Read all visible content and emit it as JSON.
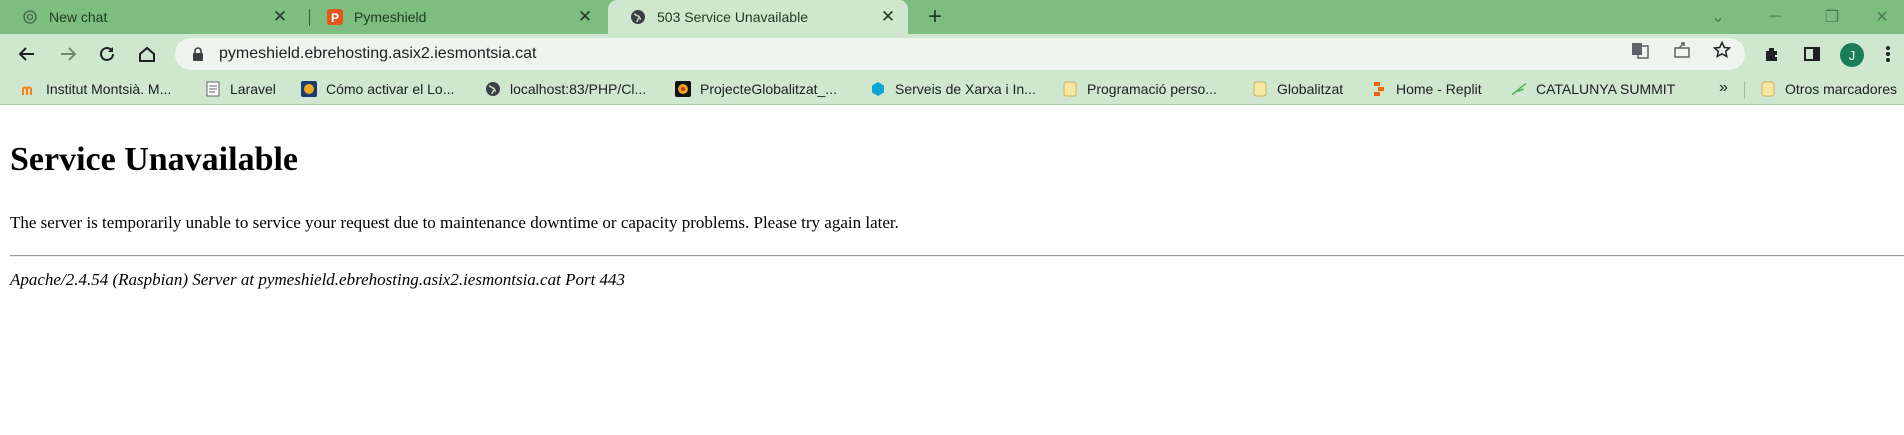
{
  "browser": {
    "tabs": [
      {
        "title": "New chat",
        "favicon": "openai-icon"
      },
      {
        "title": "Pymeshield",
        "favicon": "pymeshield-p-icon"
      },
      {
        "title": "503 Service Unavailable",
        "favicon": "globe-icon",
        "active": true
      }
    ],
    "new_tab_label": "+",
    "address": "pymeshield.ebrehosting.asix2.iesmontsia.cat",
    "profile_initial": "J",
    "colors": {
      "frame": "#7dbd7f",
      "toolbar": "#cfe6cf",
      "avatar": "#1b7c5a"
    }
  },
  "bookmarks": {
    "items": [
      {
        "label": "Institut Montsià. M...",
        "icon": "moodle-icon"
      },
      {
        "label": "Laravel",
        "icon": "page-icon"
      },
      {
        "label": "Cómo activar el Lo...",
        "icon": "brain-icon"
      },
      {
        "label": "localhost:83/PHP/Cl...",
        "icon": "globe-icon"
      },
      {
        "label": "ProjecteGlobalitzat_...",
        "icon": "app-icon"
      },
      {
        "label": "Serveis de Xarxa i In...",
        "icon": "hexagon-icon"
      },
      {
        "label": "Programació perso...",
        "icon": "folder-icon"
      },
      {
        "label": "Globalitzat",
        "icon": "folder-icon"
      },
      {
        "label": "Home - Replit",
        "icon": "replit-icon"
      },
      {
        "label": "CATALUNYA SUMMIT",
        "icon": "leaf-icon"
      }
    ],
    "more_label": "»",
    "other_label": "Otros marcadores"
  },
  "page": {
    "heading": "Service Unavailable",
    "message": "The server is temporarily unable to service your request due to maintenance downtime or capacity problems. Please try again later.",
    "server_signature": "Apache/2.4.54 (Raspbian) Server at pymeshield.ebrehosting.asix2.iesmontsia.cat Port 443"
  }
}
